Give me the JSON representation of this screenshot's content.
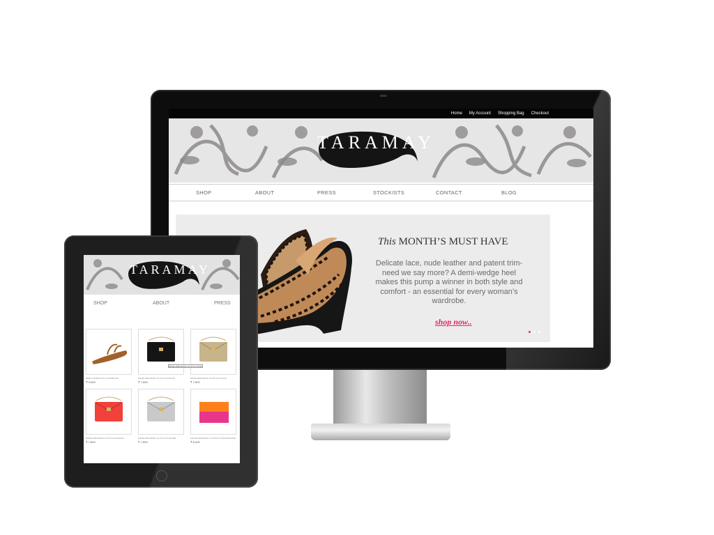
{
  "desktop": {
    "topbar": {
      "links": [
        "Home",
        "My Account",
        "Shopping Bag",
        "Checkout"
      ]
    },
    "logo": {
      "text": "TARAMAY"
    },
    "nav": {
      "items": [
        "SHOP",
        "ABOUT",
        "PRESS",
        "STOCKISTS",
        "CONTACT",
        "BLOG"
      ]
    },
    "hero": {
      "title_italic": "This",
      "title_rest": " MONTH’S MUST HAVE",
      "description": "Delicate lace, nude leather and patent trim-need we say more? A demi-wedge heel makes this pump a winner in both style and comfort - an essential for every woman’s wardrobe.",
      "link": "shop now..",
      "slides": 3,
      "active_slide": 1
    }
  },
  "tablet": {
    "logo": {
      "text": "TARAMAY"
    },
    "nav": {
      "items": [
        "SHOP",
        "ABOUT",
        "PRESS"
      ]
    },
    "tooltip": "ENVELOPE BASIC CLUTCH IN BLACK",
    "products": [
      {
        "name": "BRIEL SANDALS IN GOLD/BLACK",
        "price": "₹ 3,000",
        "image": "sandal",
        "color": "#a0622a"
      },
      {
        "name": "ENVELOPE BASIC CLUTCH IN BLACK",
        "price": "₹ 7,800",
        "image": "clutch",
        "color": "#151515"
      },
      {
        "name": "ENVELOPE BASIC CLUTCH IN GOLD",
        "price": "₹ 7,800",
        "image": "clutch",
        "color": "#c8b48a"
      },
      {
        "name": "ENVELOPE BASIC CLUTCH IN ROUGE",
        "price": "₹ 7,800",
        "image": "clutch",
        "color": "#f0413a"
      },
      {
        "name": "ENVELOPE BASIC CLUTCH IN SILVER",
        "price": "₹ 7,800",
        "image": "clutch",
        "color": "#c9c9c9"
      },
      {
        "name": "FOLDOVER BASIC CLUTCH IN PINK/ORANGE",
        "price": "₹ 8,000",
        "image": "foldover",
        "color": "#ff7f1a",
        "color2": "#e8368b"
      }
    ]
  },
  "colors": {
    "accent": "#e12a62",
    "hero_bg": "#ececec",
    "topbar_bg": "#050505"
  }
}
